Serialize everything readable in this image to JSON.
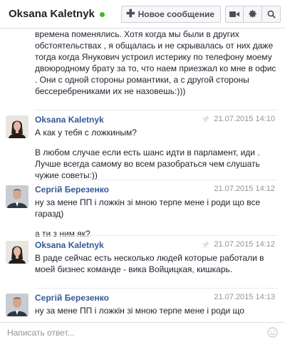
{
  "header": {
    "contact_name": "Oksana Kaletnyk",
    "new_message_label": "Новое сообщение",
    "icons": [
      "plus-icon",
      "video-icon",
      "gear-icon",
      "search-icon"
    ]
  },
  "conversation": {
    "continued_text": "времена поменялись. Хотя когда мы были в других обстоятельствах , я общалась и не скрывалась от них даже тогда когда Янукович устроил истерику по телефону моему двоюродному брату за то, что наем приезжал ко мне в офис . Они с одной стороны романтики, а с другой стороны бессеребрениками их не назовешь:)))",
    "messages": [
      {
        "sender": "Oksana Kaletnyk",
        "time": "21.07.2015 14:10",
        "paragraphs": [
          "А как у тебя с ложкиным?",
          "В любом случае если есть шанс идти в парламент, иди . Лучше всегда самому во всем разобраться чем слушать чужие советы:))"
        ]
      },
      {
        "sender": "Сергій Березенко",
        "time": "21.07.2015 14:12",
        "paragraphs": [
          "ну за мене ПП і ложкін зі мною терпе мене і роди що все гаразд)",
          "а ти з ним як?"
        ]
      },
      {
        "sender": "Oksana Kaletnyk",
        "time": "21.07.2015 14:12",
        "paragraphs": [
          "В раде сейчас есть несколько людей которые работали в моей бизнес команде - вика Войцицкая, кишкарь."
        ]
      },
      {
        "sender": "Сергій Березенко",
        "time": "21.07.2015 14:13",
        "paragraphs": [
          "ну за мене ПП і ложкін зі мною терпе мене і роди що"
        ]
      }
    ]
  },
  "composer": {
    "placeholder": "Написать ответ..."
  },
  "colors": {
    "online": "#42b72a",
    "sender_name": "#365899",
    "timestamp": "#90949c",
    "border": "#dddfe2"
  }
}
